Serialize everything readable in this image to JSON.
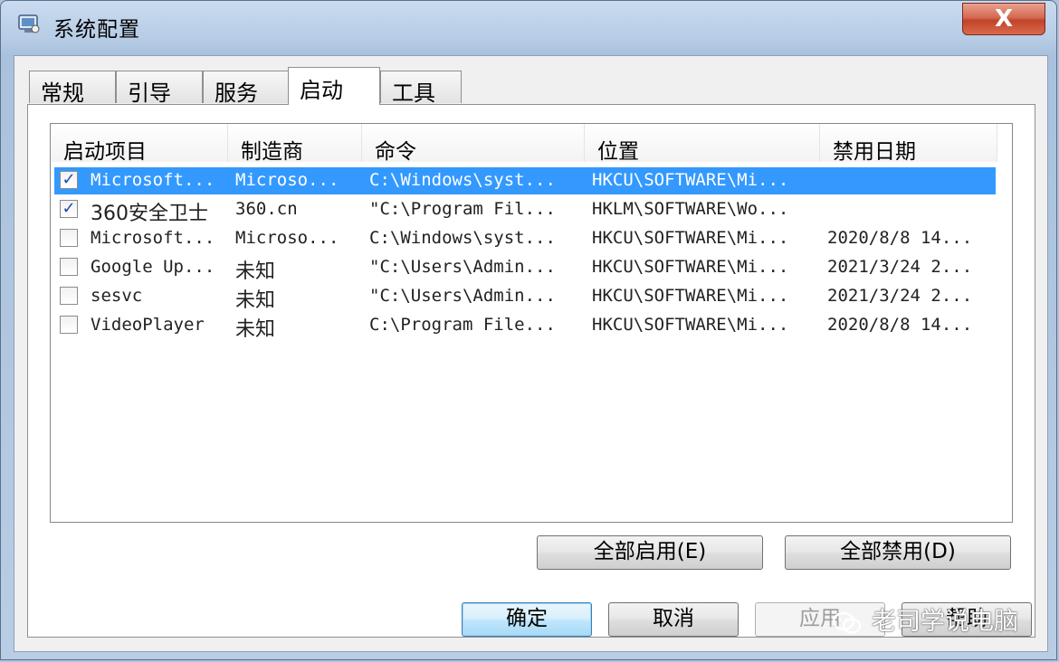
{
  "window": {
    "title": "系统配置",
    "close_label": "X"
  },
  "tabs": [
    {
      "label": "常规",
      "active": false
    },
    {
      "label": "引导",
      "active": false
    },
    {
      "label": "服务",
      "active": false
    },
    {
      "label": "启动",
      "active": true
    },
    {
      "label": "工具",
      "active": false
    }
  ],
  "startup_table": {
    "columns": [
      "启动项目",
      "制造商",
      "命令",
      "位置",
      "禁用日期"
    ],
    "rows": [
      {
        "checked": true,
        "selected": true,
        "item": "Microsoft...",
        "maker": "Microso...",
        "command": "C:\\Windows\\syst...",
        "location": "HKCU\\SOFTWARE\\Mi...",
        "disabled_date": ""
      },
      {
        "checked": true,
        "selected": false,
        "item": "360安全卫士",
        "maker": "360.cn",
        "command": "\"C:\\Program Fil...",
        "location": "HKLM\\SOFTWARE\\Wo...",
        "disabled_date": ""
      },
      {
        "checked": false,
        "selected": false,
        "item": "Microsoft...",
        "maker": "Microso...",
        "command": "C:\\Windows\\syst...",
        "location": "HKCU\\SOFTWARE\\Mi...",
        "disabled_date": "2020/8/8 14..."
      },
      {
        "checked": false,
        "selected": false,
        "item": "Google Up...",
        "maker": "未知",
        "command": "\"C:\\Users\\Admin...",
        "location": "HKCU\\SOFTWARE\\Mi...",
        "disabled_date": "2021/3/24 2..."
      },
      {
        "checked": false,
        "selected": false,
        "item": "sesvc",
        "maker": "未知",
        "command": "\"C:\\Users\\Admin...",
        "location": "HKCU\\SOFTWARE\\Mi...",
        "disabled_date": "2021/3/24 2..."
      },
      {
        "checked": false,
        "selected": false,
        "item": "VideoPlayer",
        "maker": "未知",
        "command": "C:\\Program File...",
        "location": "HKCU\\SOFTWARE\\Mi...",
        "disabled_date": "2020/8/8 14..."
      }
    ]
  },
  "buttons": {
    "enable_all": "全部启用(E)",
    "disable_all": "全部禁用(D)",
    "ok": "确定",
    "cancel": "取消",
    "apply": "应用",
    "help": "帮助"
  },
  "watermark": {
    "text": "老司学说电脑",
    "icon": "wechat-icon"
  },
  "colors": {
    "selection": "#3399ff",
    "checkmark": "#1c4aa8",
    "close_button": "#c2432a"
  }
}
